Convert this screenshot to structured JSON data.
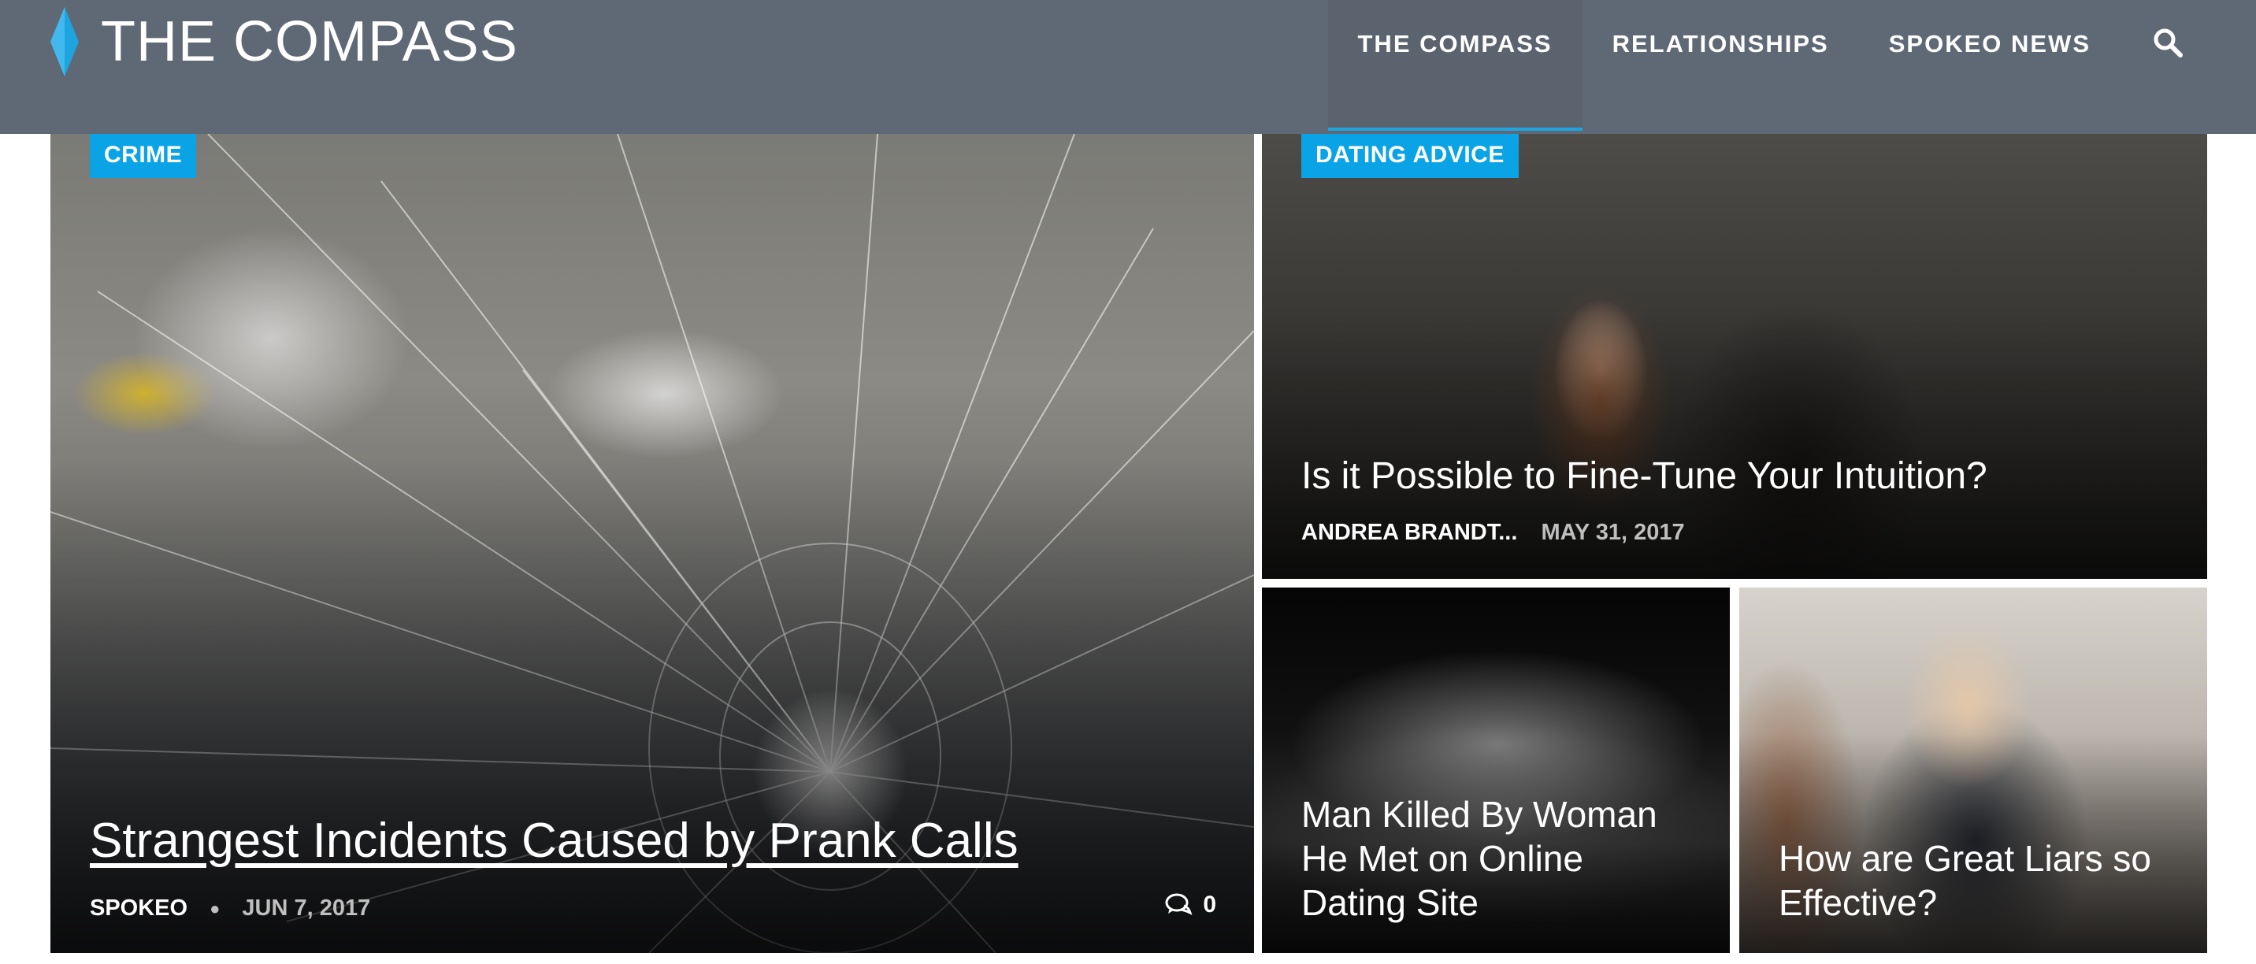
{
  "site": {
    "logo_text": "THE COMPASS",
    "brand_accent": "#1ea4df",
    "header_bg": "#5f6975"
  },
  "nav": {
    "items": [
      {
        "label": "THE COMPASS",
        "active": true
      },
      {
        "label": "RELATIONSHIPS",
        "active": false
      },
      {
        "label": "SPOKEO NEWS",
        "active": false
      }
    ],
    "search_icon": "search-icon"
  },
  "featured": {
    "tag": "CRIME",
    "title": "Strangest Incidents Caused by Prank Calls",
    "author": "SPOKEO",
    "date": "JUN 7, 2017",
    "comments": "0",
    "comment_icon": "comment-bubble-icon"
  },
  "cards": [
    {
      "tag": "DATING ADVICE",
      "title": "Is it Possible to Fine-Tune Your Intuition?",
      "author": "ANDREA BRANDT...",
      "date": "MAY 31, 2017"
    },
    {
      "title_lines": [
        "Man Killed By Woman",
        "He Met on Online",
        "Dating Site"
      ]
    },
    {
      "title_lines": [
        "How are Great Liars so",
        "Effective?"
      ]
    }
  ],
  "tag_color": "#0aa3e6"
}
